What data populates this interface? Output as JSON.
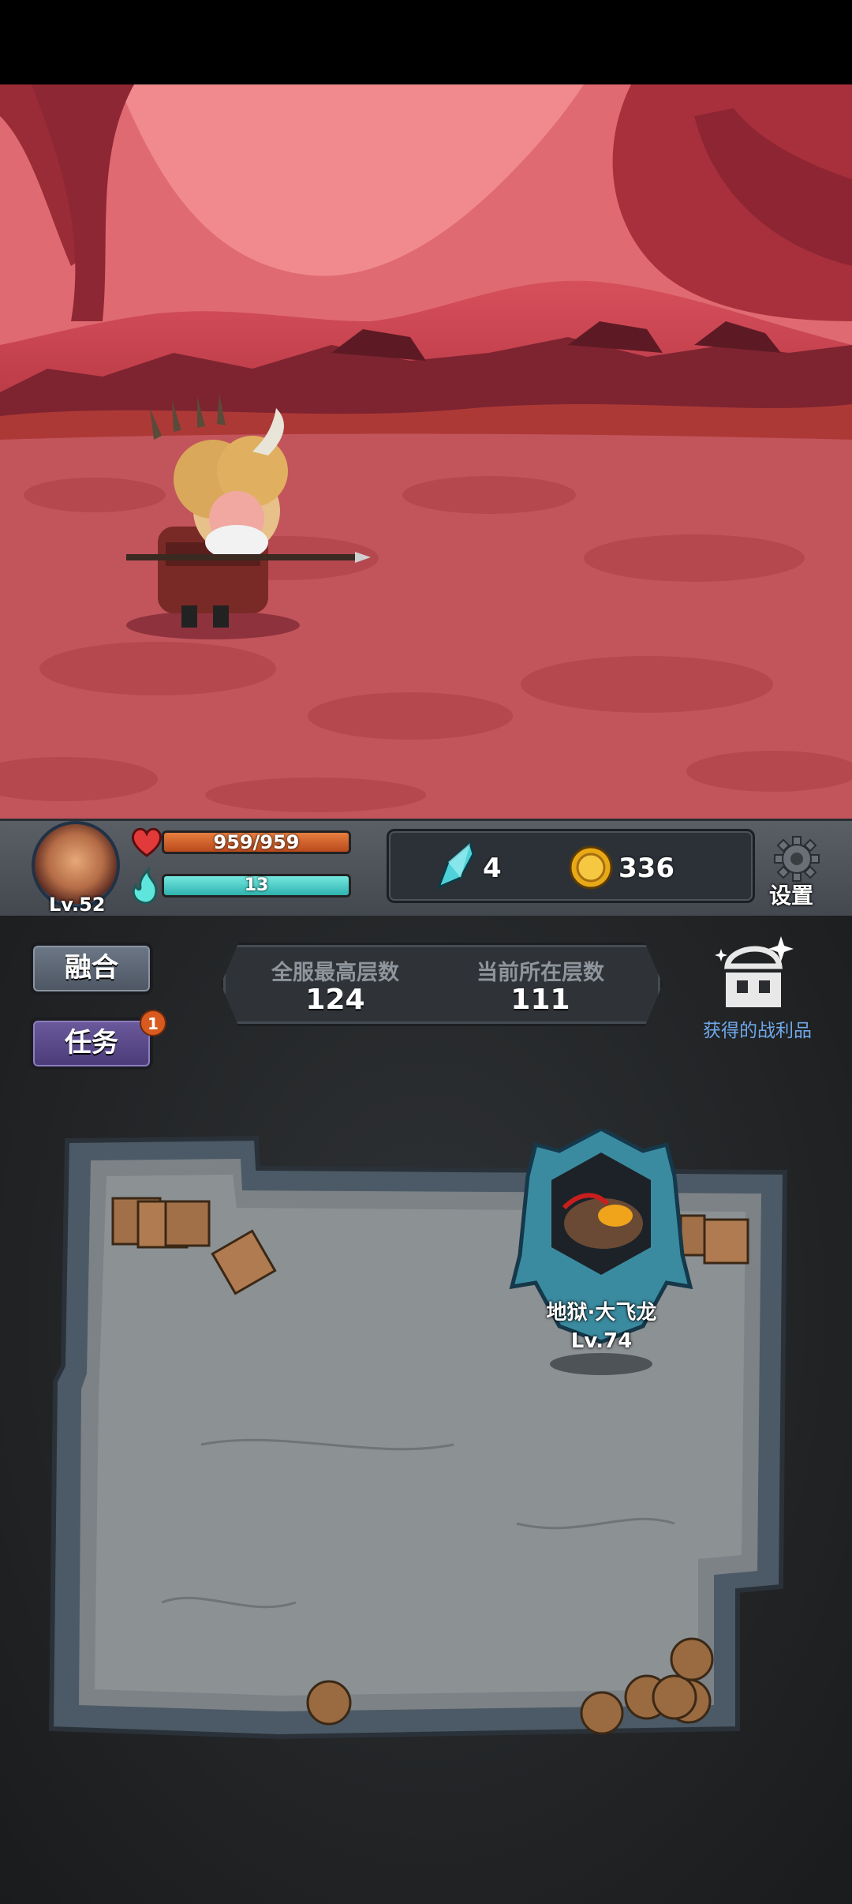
{
  "player": {
    "level_label": "Lv.52",
    "hp_text": "959/959",
    "hp_fraction": 1.0,
    "mp_text": "13",
    "mp_fraction": 1.0
  },
  "currency": {
    "crystal": "4",
    "coin": "336"
  },
  "settings": {
    "label": "设置"
  },
  "buttons": {
    "fuse": "融合",
    "task": "任务",
    "task_badge": "1"
  },
  "floors": {
    "server_best_label": "全服最高层数",
    "server_best_value": "124",
    "current_label": "当前所在层数",
    "current_value": "111"
  },
  "loot": {
    "label": "获得的战利品"
  },
  "boss": {
    "name": "地狱·大飞龙",
    "level": "Lv.74"
  },
  "colors": {
    "hp": "#e77d3f",
    "mp": "#2fb2ae",
    "loot_text": "#6fa8e8",
    "task_button": "#5a4a8a",
    "fuse_button": "#5d6774"
  }
}
